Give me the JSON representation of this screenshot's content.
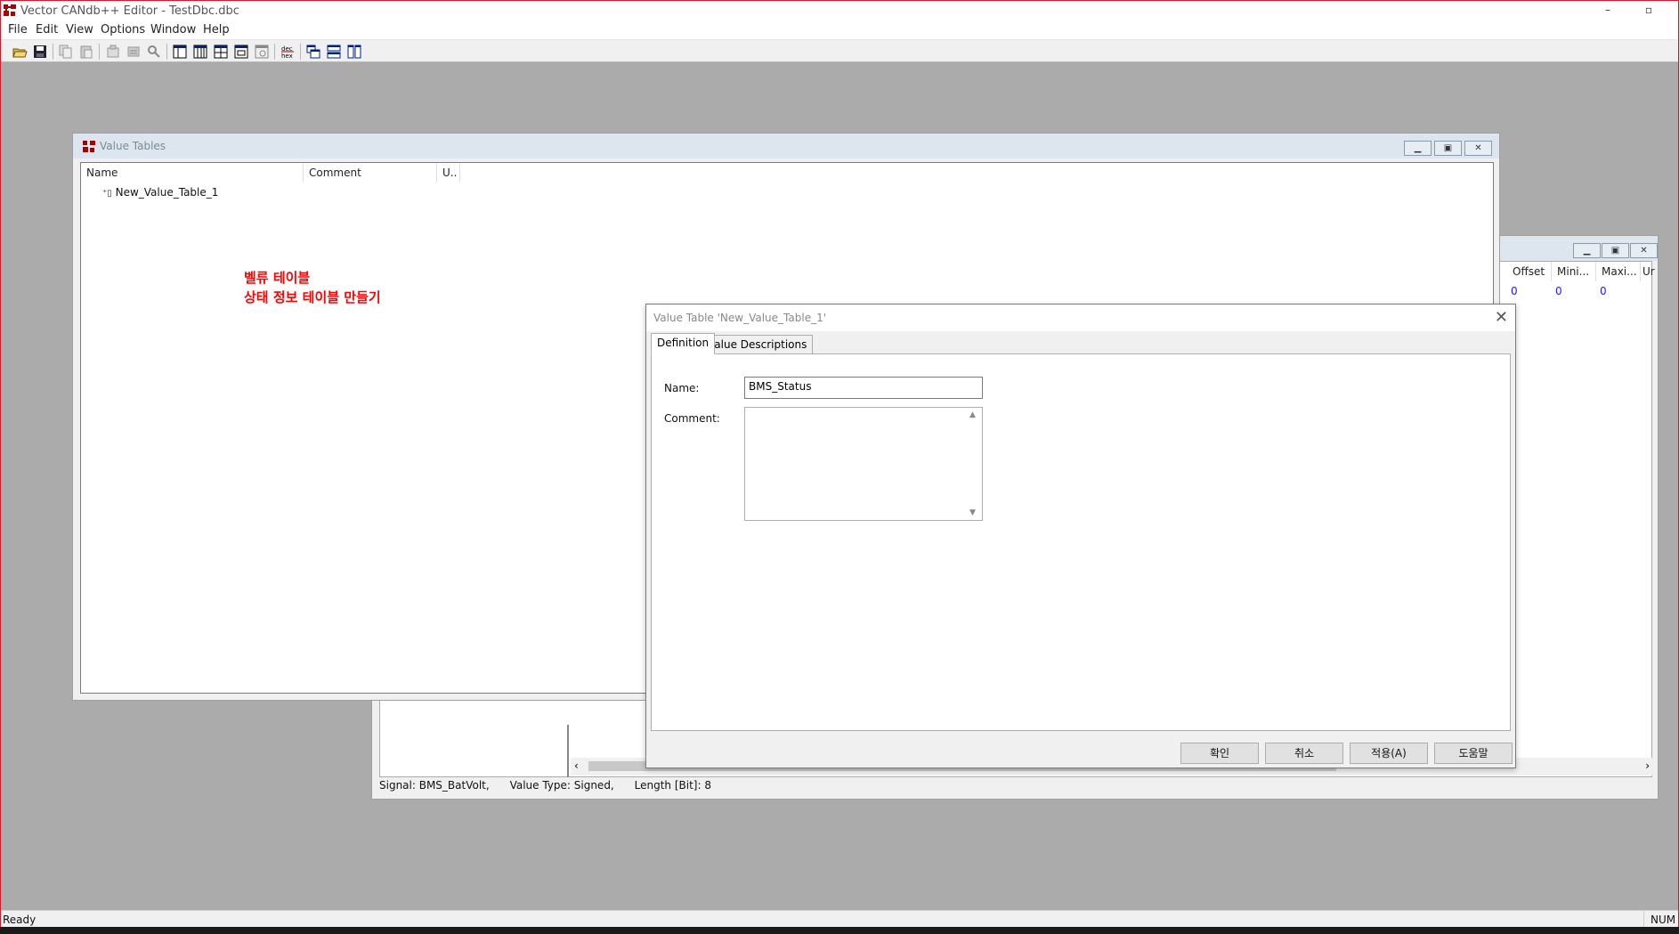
{
  "app": {
    "title": "Vector CANdb++ Editor - TestDbc.dbc",
    "minimize": "–",
    "restore": "▫"
  },
  "menu": [
    "File",
    "Edit",
    "View",
    "Options",
    "Window",
    "Help"
  ],
  "toolbar": {
    "icons": [
      "open-icon",
      "save-icon",
      "copy-icon",
      "paste-icon",
      "properties-icon",
      "network-icon",
      "find-icon",
      "view-list-1-icon",
      "view-list-2-icon",
      "view-list-3-icon",
      "view-list-4-icon",
      "view-list-5-icon",
      "dec-hex-icon",
      "cascade-icon",
      "tile-horizontal-icon",
      "tile-vertical-icon"
    ],
    "dec_hex_label": "dec hex"
  },
  "value_tables_window": {
    "title": "Value Tables",
    "columns": [
      "Name",
      "Comment",
      "U.."
    ],
    "items": [
      "New_Value_Table_1"
    ]
  },
  "annotation": {
    "line1": "벨류 테이블",
    "line2": "상태 정보 테이블 만들기",
    "color": "#ff0000"
  },
  "signals_window": {
    "columns": [
      "Offset",
      "Mini...",
      "Maxi...",
      "Ur"
    ],
    "row": [
      "0",
      "0",
      "0"
    ],
    "status": "Signal: BMS_BatVolt,      Value Type: Signed,      Length [Bit]: 8"
  },
  "dialog": {
    "title": "Value Table 'New_Value_Table_1'",
    "tabs": [
      "Definition",
      "Value Descriptions"
    ],
    "name_label": "Name:",
    "name_value": "BMS_Status",
    "comment_label": "Comment:",
    "comment_value": "",
    "buttons": {
      "ok": "확인",
      "cancel": "취소",
      "apply": "적용(A)",
      "help": "도움말"
    }
  },
  "statusbar": {
    "left": "Ready",
    "right": "NUM"
  }
}
